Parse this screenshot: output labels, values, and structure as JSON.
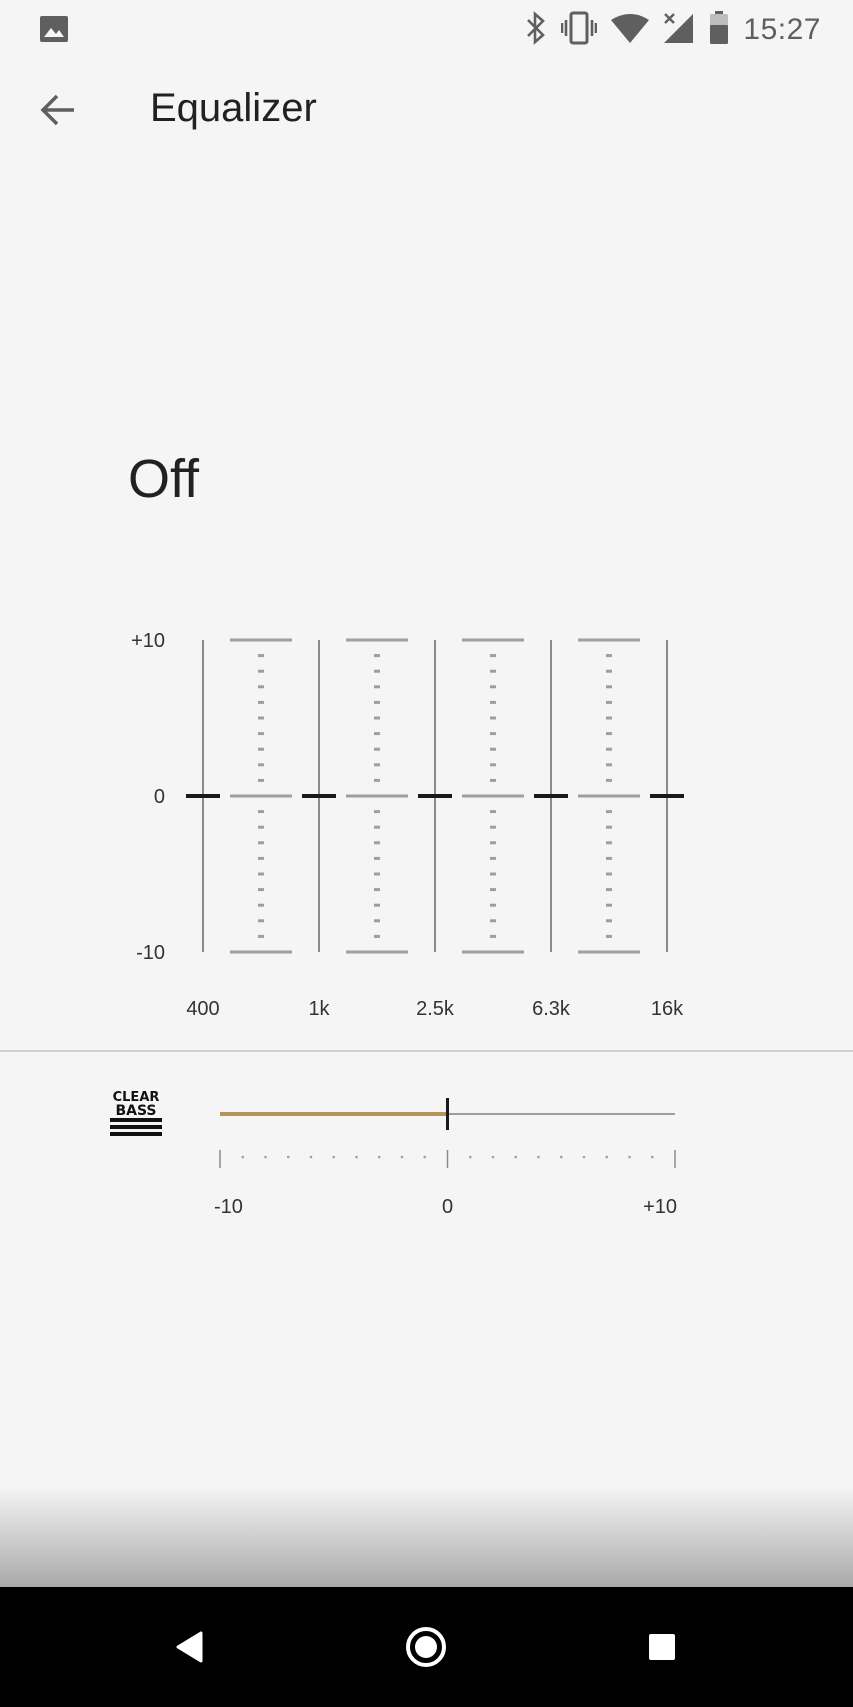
{
  "status_bar": {
    "time": "15:27",
    "left_icons": [
      "image-notification-icon"
    ],
    "right_icons": [
      "bluetooth-icon",
      "vibrate-icon",
      "wifi-icon",
      "cellular-no-signal-icon",
      "battery-icon"
    ]
  },
  "app_bar": {
    "title": "Equalizer",
    "back_icon": "arrow-back-icon"
  },
  "preset": {
    "label": "Off"
  },
  "equalizer": {
    "y_tick_labels": [
      "+10",
      "0",
      "-10"
    ],
    "band_labels": [
      "400",
      "1k",
      "2.5k",
      "6.3k",
      "16k"
    ],
    "band_values_db": [
      0,
      0,
      0,
      0,
      0
    ],
    "range": [
      -10,
      10
    ],
    "slider_color": "#1a1a1a",
    "guide_color": "#9e9e9e"
  },
  "clear_bass": {
    "logo_text_top": "CLEAR",
    "logo_text_bottom": "BASS",
    "value": 0,
    "range": [
      -10,
      10
    ],
    "tick_labels": [
      "-10",
      "0",
      "+10"
    ],
    "fill_color": "#b5935a",
    "track_color": "#9e9e9e"
  },
  "nav_bar": {
    "buttons": [
      "back-triangle-icon",
      "home-circle-icon",
      "recents-square-icon"
    ]
  }
}
